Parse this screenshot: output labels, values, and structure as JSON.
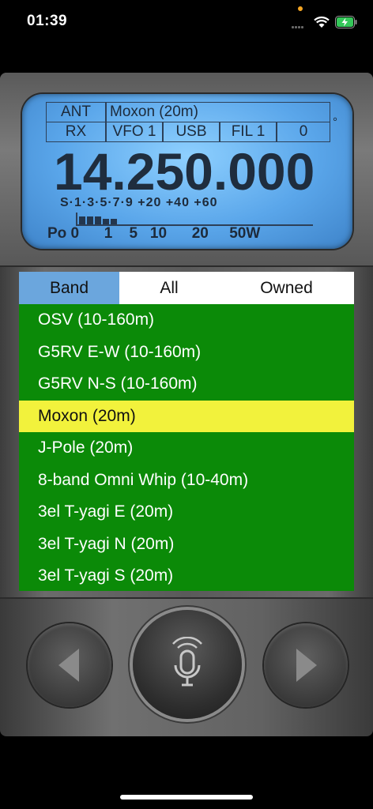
{
  "status": {
    "time": "01:39"
  },
  "lcd": {
    "ant_label": "ANT",
    "antenna": "Moxon (20m)",
    "mode_cells": [
      "RX",
      "VFO 1",
      "USB",
      "FIL 1",
      "0"
    ],
    "degree": "°",
    "frequency": "14.250.000",
    "smeter_scale": "S·1·3·5·7·9  +20 +40 +60",
    "power_scale": "Po 0      1    5   10      20     50W"
  },
  "tabs": [
    {
      "label": "Band",
      "active": true
    },
    {
      "label": "All",
      "active": false
    },
    {
      "label": "Owned",
      "active": false
    }
  ],
  "antennas": [
    {
      "label": "OSV (10-160m)",
      "selected": false
    },
    {
      "label": "G5RV E-W (10-160m)",
      "selected": false
    },
    {
      "label": "G5RV N-S (10-160m)",
      "selected": false
    },
    {
      "label": "Moxon (20m)",
      "selected": true
    },
    {
      "label": "J-Pole (20m)",
      "selected": false
    },
    {
      "label": "8-band Omni Whip (10-40m)",
      "selected": false
    },
    {
      "label": "3el T-yagi E (20m)",
      "selected": false
    },
    {
      "label": "3el T-yagi N (20m)",
      "selected": false
    },
    {
      "label": "3el T-yagi S (20m)",
      "selected": false
    }
  ],
  "colors": {
    "list_bg": "#0b8a08",
    "selected_bg": "#f2f23c",
    "tab_active": "#6ba6dd",
    "lcd": "#5aa6ea"
  },
  "icons": {
    "prev": "triangle-left-icon",
    "ptt": "microphone-icon",
    "next": "triangle-right-icon"
  }
}
